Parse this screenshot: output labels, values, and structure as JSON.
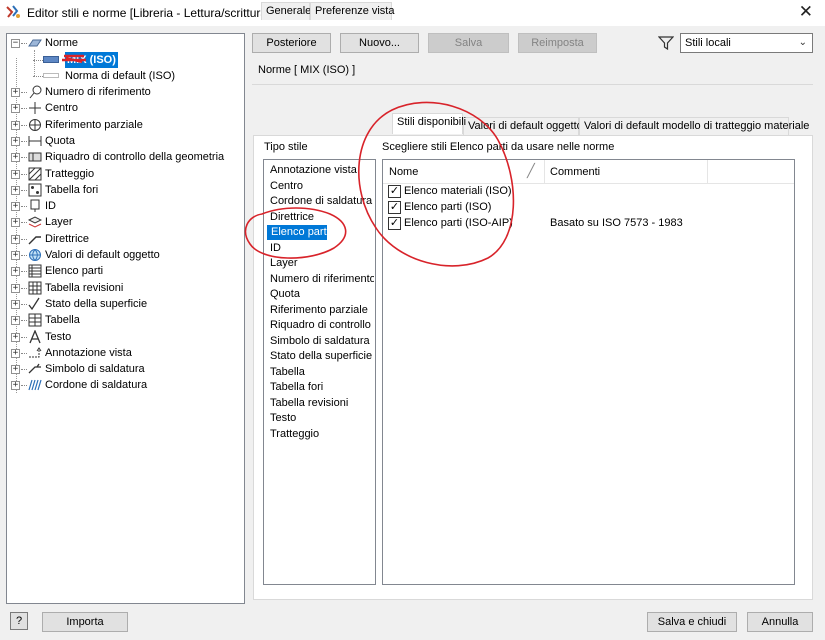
{
  "window": {
    "title": "Editor stili e norme [Libreria - Lettura/scrittura]",
    "close_label": "✕"
  },
  "tree": {
    "root_label": "Norme",
    "selected_child_label": "MIX (ISO)",
    "default_child_label": "Norma di default (ISO)",
    "items": [
      {
        "label": "Numero di riferimento",
        "icon": "balloon-icon"
      },
      {
        "label": "Centro",
        "icon": "center-mark-icon"
      },
      {
        "label": "Riferimento parziale",
        "icon": "datum-target-icon"
      },
      {
        "label": "Quota",
        "icon": "dimension-icon"
      },
      {
        "label": "Riquadro di controllo della geometria",
        "icon": "feature-control-frame-icon"
      },
      {
        "label": "Tratteggio",
        "icon": "hatch-icon"
      },
      {
        "label": "Tabella fori",
        "icon": "hole-table-icon"
      },
      {
        "label": "ID",
        "icon": "id-icon"
      },
      {
        "label": "Layer",
        "icon": "layer-icon"
      },
      {
        "label": "Direttrice",
        "icon": "leader-icon"
      },
      {
        "label": "Valori di default oggetto",
        "icon": "globe-icon"
      },
      {
        "label": "Elenco parti",
        "icon": "parts-list-icon"
      },
      {
        "label": "Tabella revisioni",
        "icon": "revision-table-icon"
      },
      {
        "label": "Stato della superficie",
        "icon": "surface-texture-icon"
      },
      {
        "label": "Tabella",
        "icon": "table-icon"
      },
      {
        "label": "Testo",
        "icon": "text-icon"
      },
      {
        "label": "Annotazione vista",
        "icon": "view-annotation-icon"
      },
      {
        "label": "Simbolo di saldatura",
        "icon": "weld-symbol-icon"
      },
      {
        "label": "Cordone di saldatura",
        "icon": "weld-bead-icon"
      }
    ]
  },
  "toolbar": {
    "back_label": "Posteriore",
    "new_label": "Nuovo...",
    "save_label": "Salva",
    "reset_label": "Reimposta",
    "filter_value": "Stili locali"
  },
  "main": {
    "section_title": "Norme [ MIX (ISO) ]",
    "tabs": [
      {
        "label": "Generale"
      },
      {
        "label": "Preferenze vista"
      },
      {
        "label": "Stili disponibili"
      },
      {
        "label": "Valori di default oggetto"
      },
      {
        "label": "Valori di default modello di tratteggio materiale"
      }
    ],
    "style_type_label": "Tipo stile",
    "choose_label": "Scegliere stili Elenco parti da usare nelle norme",
    "style_types": [
      "Annotazione vista",
      "Centro",
      "Cordone di saldatura",
      "Direttrice",
      "Elenco parti",
      "ID",
      "Layer",
      "Numero di riferimento",
      "Quota",
      "Riferimento parziale",
      "Riquadro di controllo ...",
      "Simbolo di saldatura",
      "Stato della superficie",
      "Tabella",
      "Tabella fori",
      "Tabella revisioni",
      "Testo",
      "Tratteggio"
    ],
    "selected_style_type": "Elenco parti",
    "grid_headers": {
      "name": "Nome",
      "comments": "Commenti"
    },
    "grid_rows": [
      {
        "name": "Elenco materiali (ISO)",
        "checked": true,
        "comment": ""
      },
      {
        "name": "Elenco parti (ISO)",
        "checked": true,
        "comment": "Basato su ISO 7573 - 1983"
      },
      {
        "name": "Elenco parti (ISO-AIP)",
        "checked": true,
        "comment": ""
      }
    ]
  },
  "footer": {
    "help_label": "?",
    "import_label": "Importa",
    "save_close_label": "Salva e chiudi",
    "cancel_label": "Annulla"
  },
  "colors": {
    "selection": "#0078d7",
    "annotation_red": "#d8232a"
  }
}
